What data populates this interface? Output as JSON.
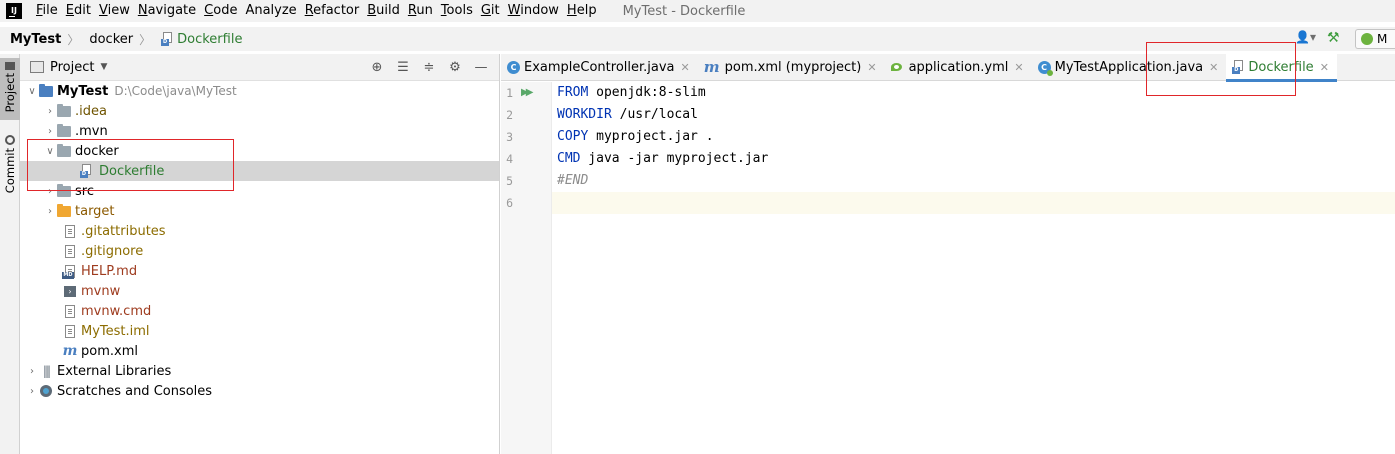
{
  "app": {
    "logo": "IJ",
    "window_title": "MyTest - Dockerfile"
  },
  "menu": [
    {
      "u": "F",
      "rest": "ile"
    },
    {
      "u": "E",
      "rest": "dit"
    },
    {
      "u": "V",
      "rest": "iew"
    },
    {
      "u": "N",
      "rest": "avigate"
    },
    {
      "u": "C",
      "rest": "ode"
    },
    {
      "u": "",
      "rest": "Analyze"
    },
    {
      "u": "R",
      "rest": "efactor"
    },
    {
      "u": "B",
      "rest": "uild"
    },
    {
      "u": "R",
      "rest": "un"
    },
    {
      "u": "T",
      "rest": "ools"
    },
    {
      "u": "G",
      "rest": "it"
    },
    {
      "u": "W",
      "rest": "indow"
    },
    {
      "u": "H",
      "rest": "elp"
    }
  ],
  "breadcrumb": {
    "project": "MyTest",
    "folder": "docker",
    "file": "Dockerfile"
  },
  "toolbar": {
    "run_config_label": "M"
  },
  "tool_stripe": {
    "project": "Project",
    "commit": "Commit"
  },
  "project_panel": {
    "title": "Project",
    "tree": {
      "root": {
        "name": "MyTest",
        "path": "D:\\Code\\java\\MyTest"
      },
      "idea": ".idea",
      "mvn": ".mvn",
      "docker": "docker",
      "dockerfile": "Dockerfile",
      "src": "src",
      "target": "target",
      "gitattributes": ".gitattributes",
      "gitignore": ".gitignore",
      "help": "HELP.md",
      "mvnw": "mvnw",
      "mvnw_cmd": "mvnw.cmd",
      "iml": "MyTest.iml",
      "pom": "pom.xml",
      "ext_libs": "External Libraries",
      "scratches": "Scratches and Consoles"
    }
  },
  "tabs": [
    {
      "label": "ExampleController.java",
      "icon": "class-icon"
    },
    {
      "label": "pom.xml (myproject)",
      "icon": "maven-icon"
    },
    {
      "label": "application.yml",
      "icon": "spring-yml-icon"
    },
    {
      "label": "MyTestApplication.java",
      "icon": "spring-class-icon"
    },
    {
      "label": "Dockerfile",
      "icon": "docker-file-icon",
      "active": true
    }
  ],
  "editor": {
    "line_numbers": [
      "1",
      "2",
      "3",
      "4",
      "5",
      "6"
    ],
    "lines": [
      {
        "kw": "FROM",
        "text": " openjdk:8-slim"
      },
      {
        "kw": "WORKDIR",
        "text": " /usr/local"
      },
      {
        "kw": "COPY",
        "text": " myproject.jar ."
      },
      {
        "kw": "CMD",
        "text": " java -jar myproject.jar"
      },
      {
        "comment": "#END"
      },
      {
        "text": ""
      }
    ]
  }
}
